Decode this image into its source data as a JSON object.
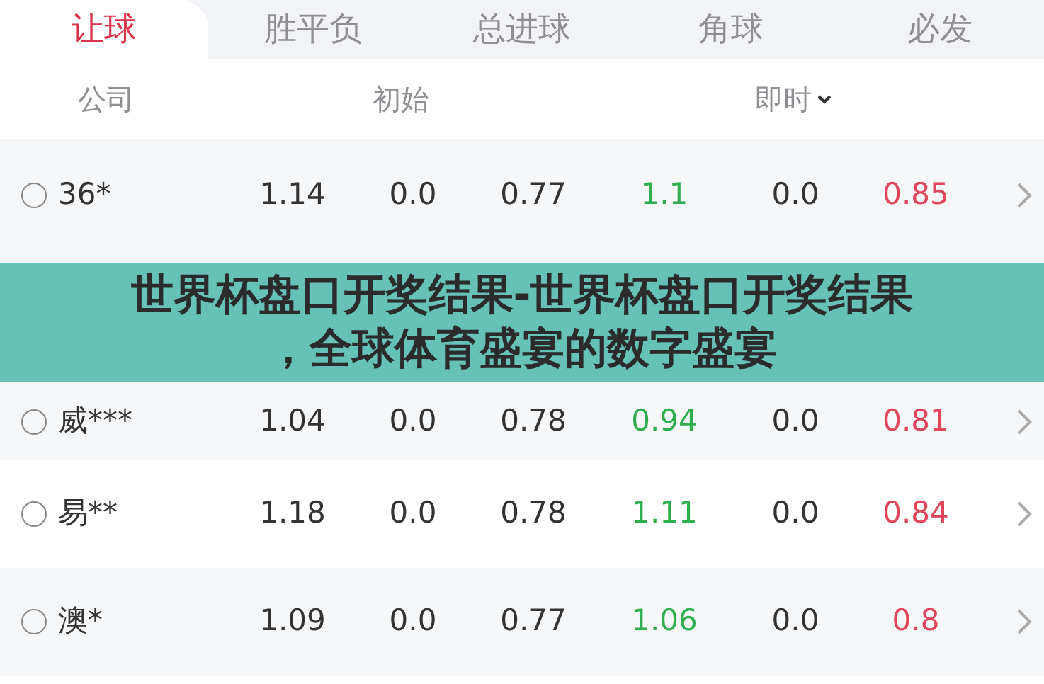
{
  "tabs": [
    {
      "label": "让球",
      "selected": true
    },
    {
      "label": "胜平负",
      "selected": false
    },
    {
      "label": "总进球",
      "selected": false
    },
    {
      "label": "角球",
      "selected": false
    },
    {
      "label": "必发",
      "selected": false
    }
  ],
  "header": {
    "company": "公司",
    "initial": "初始",
    "live": "即时"
  },
  "rows": [
    {
      "company": "36*",
      "selected": false,
      "cells": [
        {
          "text": "1.14",
          "kind": "plain"
        },
        {
          "text": "0.0",
          "kind": "plain"
        },
        {
          "text": "0.77",
          "kind": "plain"
        },
        {
          "text": "1.1",
          "kind": "up"
        },
        {
          "text": "0.0",
          "kind": "plain"
        },
        {
          "text": "0.85",
          "kind": "down"
        }
      ]
    },
    {
      "kind": "banner",
      "title": "世界杯盘口开奖结果-世界杯盘口开奖结果",
      "subtitle": "，全球体育盛宴的数字盛宴"
    },
    {
      "company": "威***",
      "selected": false,
      "cells": [
        {
          "text": "1.04",
          "kind": "plain"
        },
        {
          "text": "0.0",
          "kind": "plain"
        },
        {
          "text": "0.78",
          "kind": "plain"
        },
        {
          "text": "0.94",
          "kind": "up"
        },
        {
          "text": "0.0",
          "kind": "plain"
        },
        {
          "text": "0.81",
          "kind": "down"
        }
      ]
    },
    {
      "company": "易**",
      "selected": false,
      "cells": [
        {
          "text": "1.18",
          "kind": "plain"
        },
        {
          "text": "0.0",
          "kind": "plain"
        },
        {
          "text": "0.78",
          "kind": "plain"
        },
        {
          "text": "1.11",
          "kind": "up"
        },
        {
          "text": "0.0",
          "kind": "plain"
        },
        {
          "text": "0.84",
          "kind": "down"
        }
      ]
    },
    {
      "company": "澳*",
      "selected": false,
      "cells": [
        {
          "text": "1.09",
          "kind": "plain"
        },
        {
          "text": "0.0",
          "kind": "plain"
        },
        {
          "text": "0.77",
          "kind": "plain"
        },
        {
          "text": "1.06",
          "kind": "up"
        },
        {
          "text": "0.0",
          "kind": "plain"
        },
        {
          "text": "0.8",
          "kind": "down"
        }
      ]
    }
  ]
}
